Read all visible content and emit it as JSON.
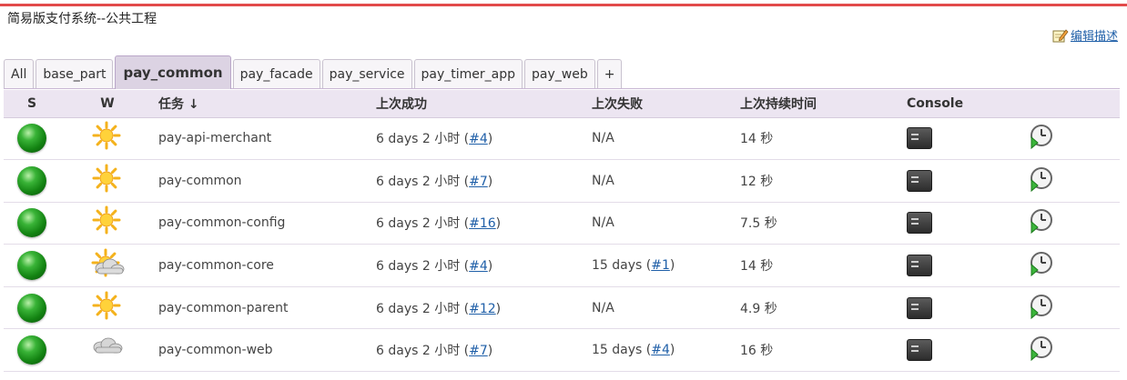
{
  "page": {
    "description": "简易版支付系统--公共工程",
    "edit_description": "编辑描述"
  },
  "tabs": [
    {
      "label": "All",
      "active": false
    },
    {
      "label": "base_part",
      "active": false
    },
    {
      "label": "pay_common",
      "active": true
    },
    {
      "label": "pay_facade",
      "active": false
    },
    {
      "label": "pay_service",
      "active": false
    },
    {
      "label": "pay_timer_app",
      "active": false
    },
    {
      "label": "pay_web",
      "active": false
    },
    {
      "label": "+",
      "active": false
    }
  ],
  "columns": {
    "s": "S",
    "w": "W",
    "name": "任务 ↓",
    "last_success": "上次成功",
    "last_failure": "上次失败",
    "last_duration": "上次持续时间",
    "console": "Console"
  },
  "jobs": [
    {
      "name": "pay-api-merchant",
      "weather": "sunny",
      "last_success": "6 days 2 小时 (",
      "ls_build": "#4",
      "last_failure": "N/A",
      "lf_build": "",
      "duration": "14 秒"
    },
    {
      "name": "pay-common",
      "weather": "sunny",
      "last_success": "6 days 2 小时 (",
      "ls_build": "#7",
      "last_failure": "N/A",
      "lf_build": "",
      "duration": "12 秒"
    },
    {
      "name": "pay-common-config",
      "weather": "sunny",
      "last_success": "6 days 2 小时 (",
      "ls_build": "#16",
      "last_failure": "N/A",
      "lf_build": "",
      "duration": "7.5 秒"
    },
    {
      "name": "pay-common-core",
      "weather": "partly-cloudy",
      "last_success": "6 days 2 小时 (",
      "ls_build": "#4",
      "last_failure": "15 days (",
      "lf_build": "#1",
      "duration": "14 秒"
    },
    {
      "name": "pay-common-parent",
      "weather": "sunny",
      "last_success": "6 days 2 小时 (",
      "ls_build": "#12",
      "last_failure": "N/A",
      "lf_build": "",
      "duration": "4.9 秒"
    },
    {
      "name": "pay-common-web",
      "weather": "cloudy",
      "last_success": "6 days 2 小时 (",
      "ls_build": "#7",
      "last_failure": "15 days (",
      "lf_build": "#4",
      "duration": "16 秒"
    }
  ],
  "icons": {
    "status": "green-ball-icon",
    "weather_sunny": "sun-icon",
    "weather_partly": "sun-cloud-icon",
    "weather_cloudy": "cloud-icon",
    "console": "terminal-icon",
    "schedule": "schedule-build-icon"
  },
  "colors": {
    "accent_bar": "#e24a4a",
    "link": "#1f5fa8",
    "header_bg": "#ece5f1",
    "active_tab": "#dcd3e3"
  }
}
